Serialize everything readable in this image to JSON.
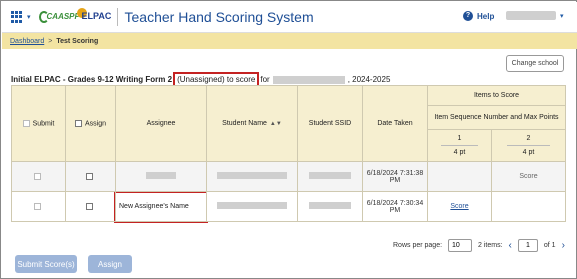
{
  "header": {
    "app_title": "Teacher Hand Scoring System",
    "logo1_text": "CAASPP",
    "logo2_text": "ELPAC",
    "help_label": "Help"
  },
  "breadcrumb": {
    "home": "Dashboard",
    "separator": ">",
    "current": "Test Scoring"
  },
  "change_school_label": "Change school",
  "heading": {
    "prefix": "Initial ELPAC - Grades 9-12 Writing Form 2",
    "highlight": "(Unassigned) to score",
    "for": "for",
    "suffix": ", 2024-2025"
  },
  "table": {
    "columns": {
      "submit": "Submit",
      "assign": "Assign",
      "assignee": "Assignee",
      "student_name": "Student Name",
      "student_ssid": "Student SSID",
      "date_taken": "Date Taken",
      "items_to_score": "Items to Score",
      "item_seq": "Item Sequence Number and Max Points"
    },
    "items": [
      {
        "number": "1",
        "points": "4 pt"
      },
      {
        "number": "2",
        "points": "4 pt"
      }
    ],
    "rows": [
      {
        "date_taken": "6/18/2024 7:31:38 PM",
        "item1": "",
        "item2": "Score"
      },
      {
        "assignee": "New Assignee's Name",
        "date_taken": "6/18/2024 7:30:34 PM",
        "item1": "Score",
        "item2": ""
      }
    ]
  },
  "pagination": {
    "rows_per_page_label": "Rows per page:",
    "rows_per_page": "10",
    "items_label": "2 items:",
    "page": "1",
    "of_label": "of 1"
  },
  "buttons": {
    "submit": "Submit Score(s)",
    "assign": "Assign"
  },
  "colors": {
    "accent": "#1f4f96",
    "breadcrumb_bg": "#f3e4a2",
    "highlight_border": "#c42222",
    "disabled_button": "#9db5d9"
  }
}
